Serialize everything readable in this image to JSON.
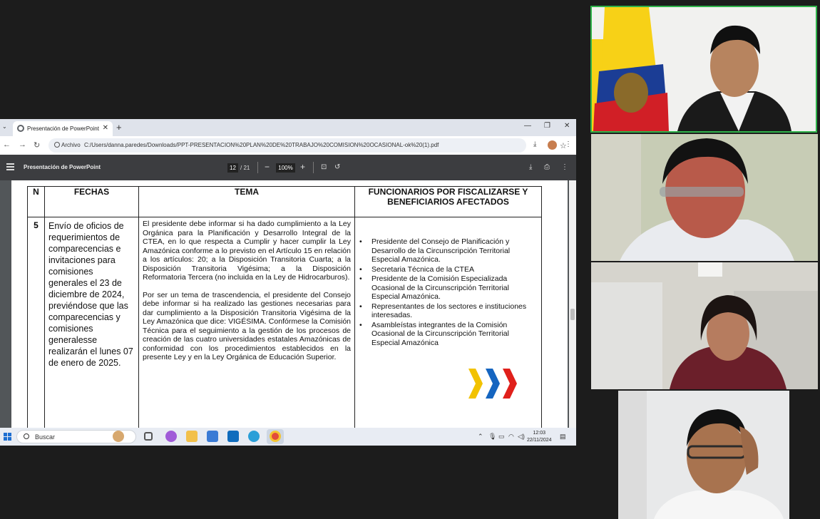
{
  "browser": {
    "tab_title": "Presentación de PowerPoint",
    "address_chip": "Archivo",
    "url": "C:/Users/danna.paredes/Downloads/PPT-PRESENTACION%20PLAN%20DE%20TRABAJO%20COMISION%20OCASIONAL-ok%20(1).pdf"
  },
  "pdf_toolbar": {
    "title": "Presentación de PowerPoint",
    "page_current": "12",
    "page_total": "/ 21",
    "zoom": "100%"
  },
  "table": {
    "headers": [
      "N",
      "FECHAS",
      "TEMA",
      "FUNCIONARIOS POR FISCALIZARSE Y BENEFICIARIOS AFECTADOS"
    ],
    "row": {
      "n": "5",
      "fechas": "Envío de oficios de requerimientos de comparecencias e invitaciones para comisiones generales el 23 de diciembre de 2024, previéndose que las comparecencias y comisiones generalesse realizarán el lunes 07 de enero de 2025.",
      "tema_p1": "El presidente debe informar si ha dado cumplimiento a la Ley Orgánica para la Planificación y Desarrollo Integral de la CTEA, en lo que respecta a Cumplir y hacer cumplir la Ley Amazónica conforme a lo previsto en el Artículo 15 en relación a los artículos: 20; a la Disposición Transitoria Cuarta; a la Disposición Transitoria Vigésima; a la Disposición Reformatoria Tercera (no incluida en la Ley de Hidrocarburos).",
      "tema_p2": "Por ser un tema de trascendencia, el presidente del Consejo debe informar si ha realizado las gestiones necesarias para dar cumplimiento a la Disposición Transitoria Vigésima de la Ley Amazónica que dice: VIGÉSIMA. Confórmese la Comisión Técnica para el seguimiento a la gestión de los procesos de creación de las cuatro universidades estatales Amazónicas de conformidad con los procedimientos establecidos en la presente Ley y en la Ley Orgánica de Educación Superior.",
      "funcionarios": [
        "Presidente del Consejo de Planificación y Desarrollo de la Circunscripción Territorial Especial Amazónica.",
        "Secretaria Técnica de la CTEA",
        "Presidente de la Comisión Especializada Ocasional de la Circunscripción Territorial Especial Amazónica.",
        "Representantes de los sectores e instituciones interesadas.",
        "Asambleístas integrantes de la Comisión Ocasional de la Circunscripción Territorial Especial Amazónica"
      ]
    }
  },
  "taskbar": {
    "search_label": "Buscar",
    "time": "12:03",
    "date": "22/11/2024"
  },
  "colors": {
    "active_speaker_border": "#2fb24a",
    "pdf_toolbar": "#3c3d40",
    "chevron_yellow": "#f2c200",
    "chevron_blue": "#1565c0",
    "chevron_red": "#e0201b"
  }
}
